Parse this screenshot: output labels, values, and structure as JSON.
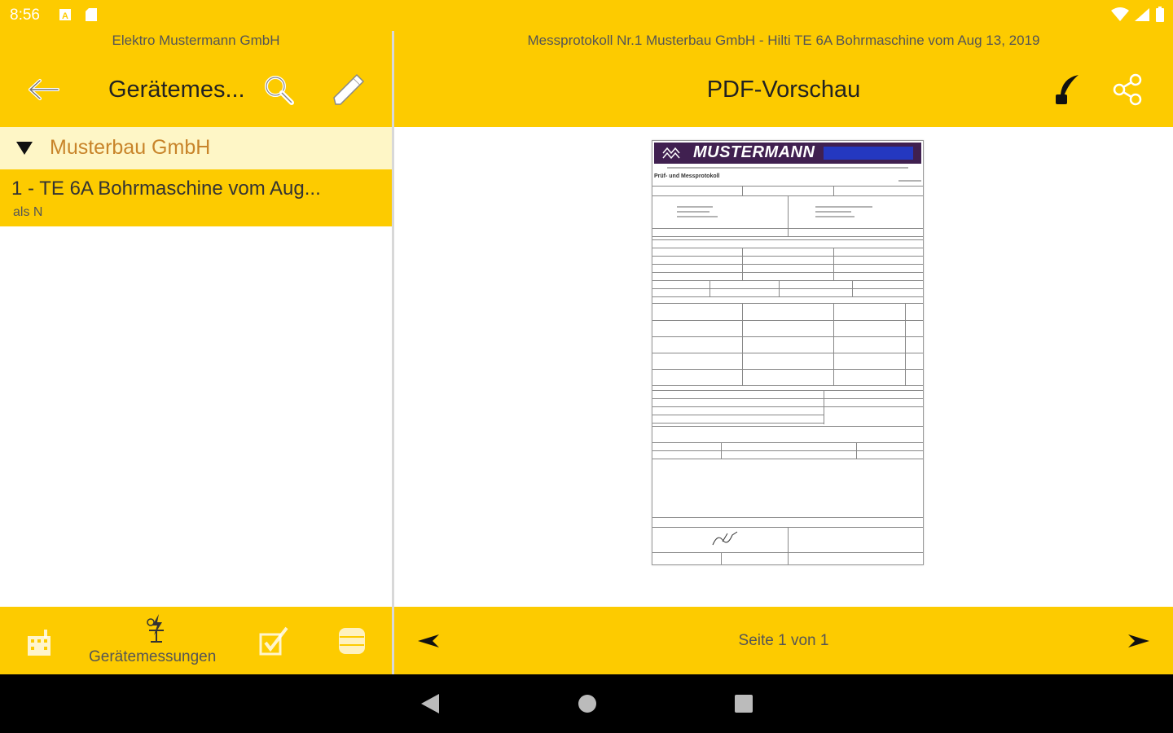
{
  "status_bar": {
    "time": "8:56"
  },
  "left_pane": {
    "subtitle": "Elektro Mustermann GmbH",
    "title": "Gerätemes...",
    "group": {
      "label": "Musterbau GmbH"
    },
    "item": {
      "title": "1 - TE 6A Bohrmaschine vom Aug...",
      "subtitle": "als N"
    },
    "footer": {
      "active_tab_label": "Gerätemessungen"
    }
  },
  "right_pane": {
    "subtitle": "Messprotokoll Nr.1 Musterbau GmbH - Hilti TE 6A Bohrmaschine vom Aug 13, 2019",
    "title": "PDF-Vorschau",
    "document": {
      "banner_text": "MUSTERMANN",
      "heading": "Prüf- und Messprotokoll"
    },
    "footer": {
      "page_indicator": "Seite 1 von 1"
    }
  },
  "colors": {
    "accent": "#fdcb00",
    "group_background": "#fef6c6",
    "group_text": "#c8842a"
  },
  "icons": [
    "back-arrow-icon",
    "search-icon",
    "pencil-icon",
    "quill-icon",
    "share-icon",
    "building-icon",
    "measurement-icon",
    "checklist-icon",
    "database-icon",
    "prev-page-icon",
    "next-page-icon"
  ]
}
